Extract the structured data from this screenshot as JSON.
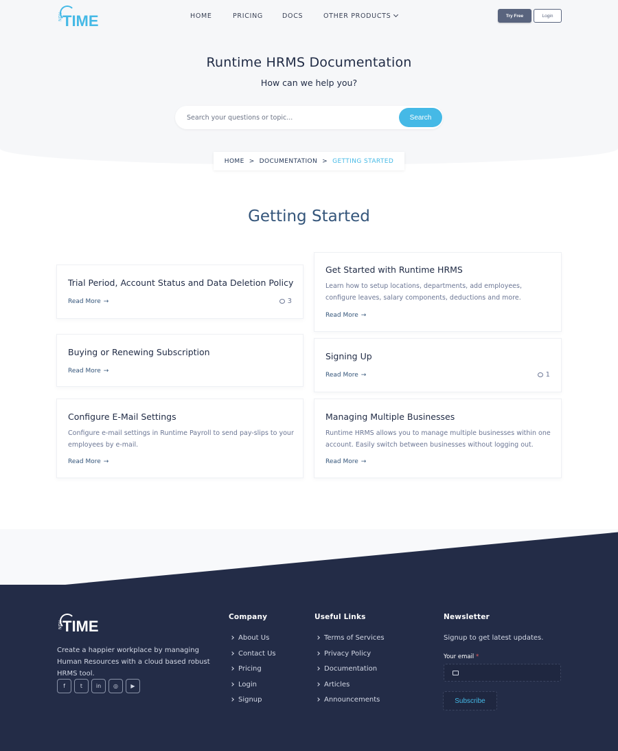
{
  "brand": {
    "logo_text": "TIME",
    "logo_small": "RUN"
  },
  "nav": {
    "home": "HOME",
    "pricing": "PRICING",
    "docs": "DOCS",
    "other_products": "OTHER PRODUCTS"
  },
  "header_buttons": {
    "try_free": "Try Free",
    "login": "Login"
  },
  "hero": {
    "title": "Runtime HRMS Documentation",
    "subtitle": "How can we help you?",
    "search_placeholder": "Search your questions or topic...",
    "search_button": "Search"
  },
  "breadcrumb": {
    "home": "HOME",
    "documentation": "DOCUMENTATION",
    "current": "GETTING STARTED",
    "separator": ">"
  },
  "section_title": "Getting Started",
  "read_more": "Read More",
  "articles": [
    {
      "title": "Trial Period, Account Status and Data Deletion Policy",
      "description": "",
      "comments": "3"
    },
    {
      "title": "Get Started with Runtime HRMS",
      "description": "Learn how to setup locations, departments, add employees, configure leaves, salary components, deductions and more.",
      "comments": ""
    },
    {
      "title": "Buying or Renewing Subscription",
      "description": "",
      "comments": ""
    },
    {
      "title": "Signing Up",
      "description": "",
      "comments": "1"
    },
    {
      "title": "Configure E-Mail Settings",
      "description": "Configure e-mail settings in Runtime Payroll to send pay-slips to your employees by e-mail.",
      "comments": ""
    },
    {
      "title": "Managing Multiple Businesses",
      "description": "Runtime HRMS allows you to manage multiple businesses within one account. Easily switch between businesses without logging out.",
      "comments": ""
    }
  ],
  "footer": {
    "description": "Create a happier workplace by managing Human Resources with a cloud based robust HRMS tool.",
    "socials": [
      "facebook-icon",
      "twitter-icon",
      "linkedin-icon",
      "instagram-icon",
      "youtube-icon"
    ],
    "company": {
      "heading": "Company",
      "links": [
        "About Us",
        "Contact Us",
        "Pricing",
        "Login",
        "Signup"
      ]
    },
    "useful_links": {
      "heading": "Useful Links",
      "links": [
        "Terms of Services",
        "Privacy Policy",
        "Documentation",
        "Articles",
        "Announcements"
      ]
    },
    "newsletter": {
      "heading": "Newsletter",
      "text": "Signup to get latest updates.",
      "email_label": "Your email",
      "required_mark": "*",
      "button": "Subscribe"
    }
  },
  "colors": {
    "accent": "#45b9e6",
    "footer_bg": "#232c47",
    "heading": "#34557a"
  }
}
